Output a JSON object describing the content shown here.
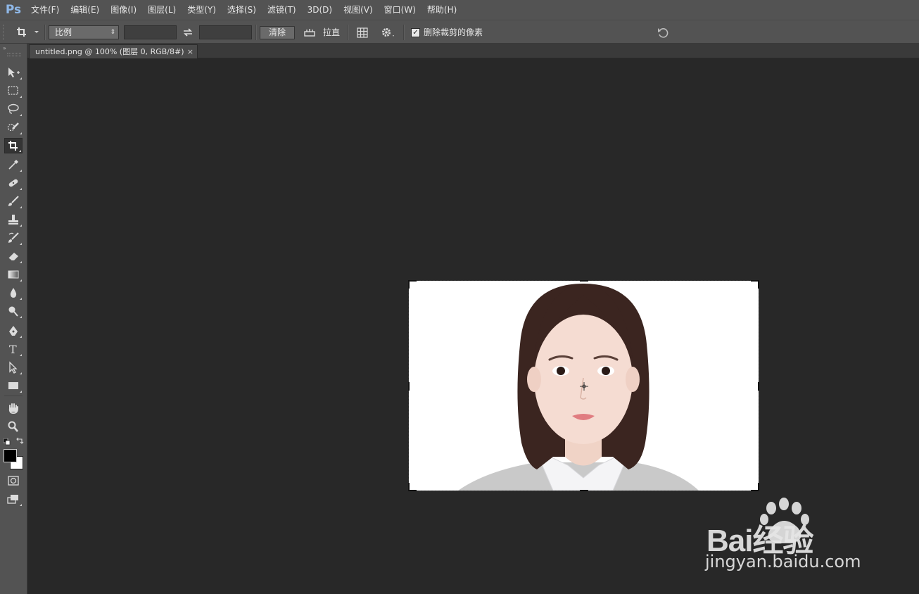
{
  "app": {
    "logo": "Ps"
  },
  "menu": [
    "文件(F)",
    "编辑(E)",
    "图像(I)",
    "图层(L)",
    "类型(Y)",
    "选择(S)",
    "滤镜(T)",
    "3D(D)",
    "视图(V)",
    "窗口(W)",
    "帮助(H)"
  ],
  "options": {
    "ratio_select": "比例",
    "width_value": "",
    "height_value": "",
    "clear_button": "清除",
    "straighten_label": "拉直",
    "delete_cropped_label": "删除裁剪的像素",
    "delete_cropped_checked": true
  },
  "document": {
    "tab_title": "untitled.png @ 100% (图层 0, RGB/8#)",
    "tab_close": "×"
  },
  "colors": {
    "foreground": "#000000",
    "background": "#ffffff",
    "panel": "#535353",
    "canvas": "#282828"
  },
  "tools": [
    "move-icon",
    "marquee-icon",
    "lasso-icon",
    "quick-selection-icon",
    "crop-icon",
    "eyedropper-icon",
    "healing-brush-icon",
    "brush-icon",
    "clone-stamp-icon",
    "history-brush-icon",
    "eraser-icon",
    "gradient-icon",
    "blur-icon",
    "dodge-icon",
    "pen-icon",
    "type-icon",
    "path-selection-icon",
    "rectangle-icon",
    "hand-icon",
    "zoom-icon"
  ],
  "watermark": {
    "brand": "Bai经验",
    "url": "jingyan.baidu.com"
  }
}
